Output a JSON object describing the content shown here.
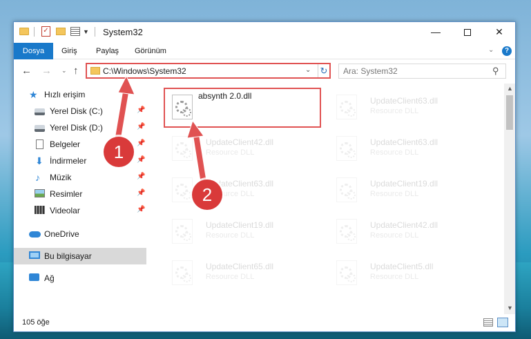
{
  "window": {
    "title": "System32",
    "controls": {
      "minimize": "—",
      "maximize": "",
      "close": "✕"
    }
  },
  "ribbon": {
    "tabs": [
      "Dosya",
      "Giriş",
      "Paylaş",
      "Görünüm"
    ],
    "collapse_icon": "chevron-down-icon",
    "help_label": "?"
  },
  "nav": {
    "address": "C:\\Windows\\System32",
    "search_placeholder": "Ara: System32"
  },
  "sidebar": {
    "items": [
      {
        "label": "Hızlı erişim",
        "icon": "star-icon",
        "pinned": false
      },
      {
        "label": "Yerel Disk (C:)",
        "icon": "drive-icon",
        "pinned": true
      },
      {
        "label": "Yerel Disk (D:)",
        "icon": "drive-icon",
        "pinned": true
      },
      {
        "label": "Belgeler",
        "icon": "documents-icon",
        "pinned": true
      },
      {
        "label": "İndirmeler",
        "icon": "downloads-icon",
        "pinned": true
      },
      {
        "label": "Müzik",
        "icon": "music-icon",
        "pinned": true
      },
      {
        "label": "Resimler",
        "icon": "pictures-icon",
        "pinned": true
      },
      {
        "label": "Videolar",
        "icon": "videos-icon",
        "pinned": true
      },
      {
        "label": "OneDrive",
        "icon": "onedrive-icon",
        "pinned": false
      },
      {
        "label": "Bu bilgisayar",
        "icon": "this-pc-icon",
        "pinned": false,
        "selected": true
      },
      {
        "label": "Ağ",
        "icon": "network-icon",
        "pinned": false
      }
    ]
  },
  "files": [
    {
      "name": "absynth 2.0.dll",
      "type": "",
      "highlighted": true
    },
    {
      "name": "UpdateClient63.dll",
      "type": "Resource DLL"
    },
    {
      "name": "UpdateClient42.dll",
      "type": "Resource DLL"
    },
    {
      "name": "UpdateClient63.dll",
      "type": "Resource DLL"
    },
    {
      "name": "UpdateClient63.dll",
      "type": "Resource DLL"
    },
    {
      "name": "UpdateClient19.dll",
      "type": "Resource DLL"
    },
    {
      "name": "UpdateClient19.dll",
      "type": "Resource DLL"
    },
    {
      "name": "UpdateClient42.dll",
      "type": "Resource DLL"
    },
    {
      "name": "UpdateClient65.dll",
      "type": "Resource DLL"
    },
    {
      "name": "UpdateClient5.dll",
      "type": "Resource DLL"
    }
  ],
  "status": {
    "item_count": "105 öğe"
  },
  "annotations": {
    "step1": "1",
    "step2": "2",
    "color": "#e05252"
  }
}
